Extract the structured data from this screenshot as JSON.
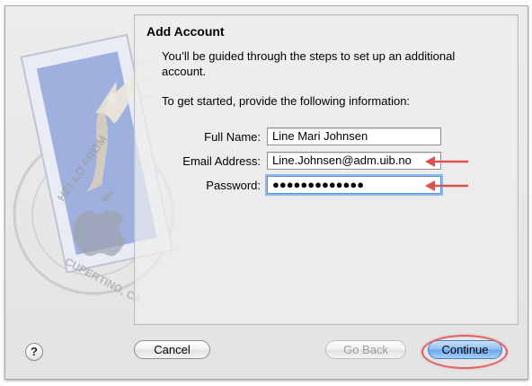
{
  "dialog": {
    "title": "Add Account",
    "intro": "You’ll be guided through the steps to set up an additional account.",
    "prompt": "To get started, provide the following information:"
  },
  "form": {
    "full_name": {
      "label": "Full Name:",
      "value": "Line Mari Johnsen"
    },
    "email": {
      "label": "Email Address:",
      "value": "Line.Johnsen@adm.uib.no"
    },
    "password": {
      "label": "Password:",
      "value": "●●●●●●●●●●●●●"
    }
  },
  "stamp": {
    "text_top": "HELLO FROM",
    "text_bottom": "CUPERTINO, CA"
  },
  "buttons": {
    "help": "?",
    "cancel": "Cancel",
    "go_back": "Go Back",
    "continue": "Continue"
  },
  "annotations": {
    "arrow_color": "#e0504a",
    "ring_color": "#e06060"
  },
  "icons": [
    "mail-stamp-icon",
    "apple-logo-icon",
    "eagle-icon",
    "arrow-left-icon",
    "help-icon"
  ]
}
